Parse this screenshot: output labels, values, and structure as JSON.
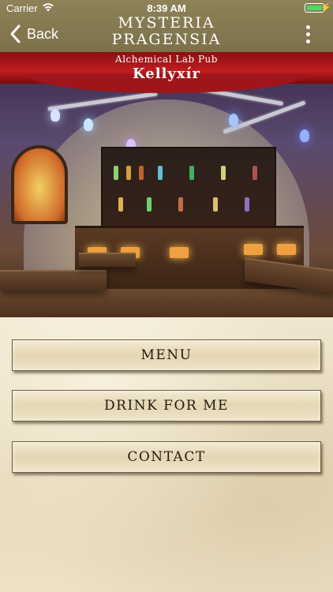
{
  "status_bar": {
    "carrier": "Carrier",
    "time": "8:39 AM",
    "battery_level": 1.0
  },
  "nav": {
    "back_label": "Back",
    "title_line1": "MYSTERIA",
    "title_line2": "PRAGENSIA",
    "more_icon": "more-vertical-icon"
  },
  "hero": {
    "subtitle": "Alchemical Lab Pub",
    "name": "Kellyxír"
  },
  "menu": {
    "items": [
      {
        "label": "MENU"
      },
      {
        "label": "DRINK FOR ME"
      },
      {
        "label": "CONTACT"
      }
    ]
  },
  "colors": {
    "nav_bar": "#857a50",
    "parchment": "#e8dcc0",
    "battery": "#4cd964"
  }
}
